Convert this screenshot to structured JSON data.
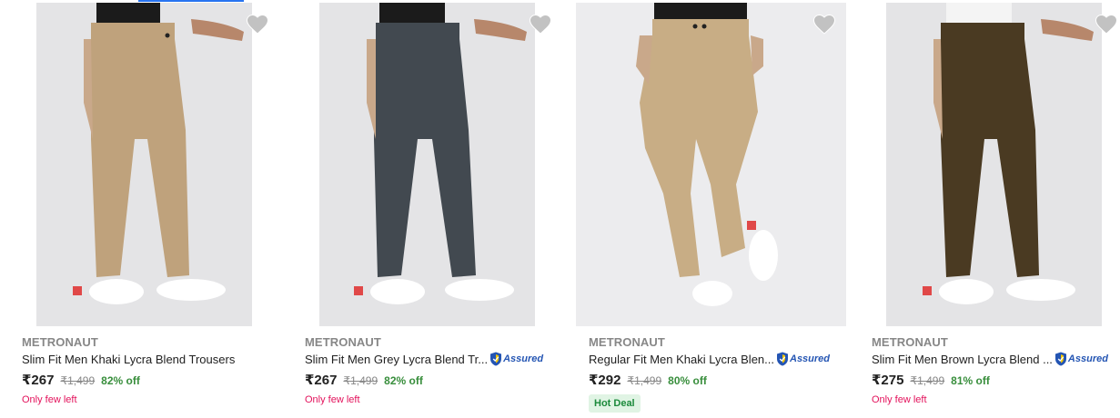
{
  "products": [
    {
      "brand": "METRONAUT",
      "title": "Slim Fit Men Khaki Lycra Blend Trousers",
      "price": "₹267",
      "mrp": "₹1,499",
      "discount": "82% off",
      "badge": "Only few left",
      "assured": false,
      "trouser_color": "#bfa27c",
      "photo_bg": "#e4e4e6",
      "wishlist_icon": "heart-icon"
    },
    {
      "brand": "METRONAUT",
      "title": "Slim Fit Men Grey Lycra Blend Tr...",
      "price": "₹267",
      "mrp": "₹1,499",
      "discount": "82% off",
      "badge": "Only few left",
      "assured": true,
      "assured_label": "Assured",
      "trouser_color": "#424950",
      "photo_bg": "#e4e4e6",
      "wishlist_icon": "heart-icon"
    },
    {
      "brand": "METRONAUT",
      "title": "Regular Fit Men Khaki Lycra Blen...",
      "price": "₹292",
      "mrp": "₹1,499",
      "discount": "80% off",
      "badge": "Hot Deal",
      "assured": true,
      "assured_label": "Assured",
      "trouser_color": "#c8ad85",
      "photo_bg": "#ececee",
      "wishlist_icon": "heart-icon"
    },
    {
      "brand": "METRONAUT",
      "title": "Slim Fit Men Brown Lycra Blend ...",
      "price": "₹275",
      "mrp": "₹1,499",
      "discount": "81% off",
      "badge": "Only few left",
      "assured": true,
      "assured_label": "Assured",
      "trouser_color": "#4a3a22",
      "photo_bg": "#e4e4e6",
      "wishlist_icon": "heart-icon"
    }
  ],
  "colors": {
    "price_off": "#388e3c",
    "stock_warning": "#e3115b",
    "hot_deal_bg": "#e0f4e4",
    "hot_deal_text": "#1b8a3b",
    "assured_blue": "#2455b3"
  }
}
